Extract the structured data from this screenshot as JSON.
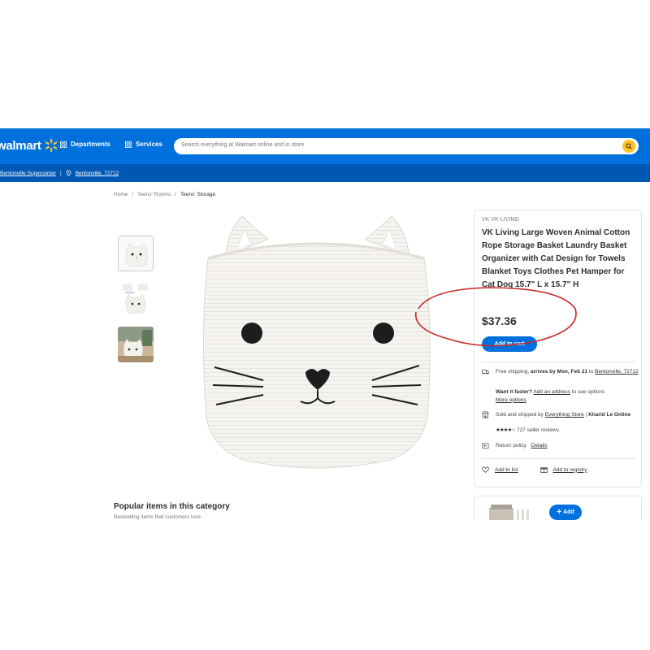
{
  "header": {
    "logo_text": "walmart",
    "departments_label": "Departments",
    "services_label": "Services",
    "search_placeholder": "Search everything at Walmart online and in store",
    "store_name": "Bentonville Supercenter",
    "location": "Bentonville, 72712",
    "colors": {
      "primary": "#0071dc",
      "secondary": "#0058b5",
      "spark": "#ffc220"
    }
  },
  "breadcrumb": [
    "Home",
    "Teens' Rooms",
    "Teens' Storage"
  ],
  "gallery": {
    "thumbnails": [
      "cat-basket-front",
      "cat-basket-variants",
      "cat-basket-lifestyle"
    ],
    "selected_index": 0
  },
  "product": {
    "brand": "VK VK-LIVING",
    "title": "VK Living Large Woven Animal Cotton Rope Storage Basket Laundry Basket Organizer with Cat Design for Towels Blanket Toys Clothes Pet Hamper for Cat Dog 15.7\" L x 15.7\" H",
    "price": "$37.36",
    "add_to_cart_label": "Add to cart"
  },
  "fulfillment": {
    "shipping_prefix": "Free shipping,",
    "shipping_bold": "arrives by Mon, Feb 21",
    "shipping_to": "to",
    "shipping_location": "Bentonville, 72712",
    "faster_label": "Want it faster?",
    "add_address_link": "Add an address",
    "see_options_text": "to see options",
    "more_options_link": "More options"
  },
  "seller": {
    "sold_by_prefix": "Sold and shipped by",
    "sold_by_link": "Everything Store",
    "separator": "|",
    "seller_name": "Kharid Le Online",
    "stars": "★★★★☆",
    "rating": 3.5,
    "reviews_text": "727 seller reviews"
  },
  "returns": {
    "label": "Return policy",
    "details_link": "Details"
  },
  "actions": {
    "add_to_list": "Add to list",
    "add_to_registry": "Add to registry"
  },
  "popular": {
    "title": "Popular items in this category",
    "subtitle": "Bestselling items that customers love"
  },
  "recommendation": {
    "add_label": "Add"
  },
  "annotation": {
    "color": "#c62828"
  }
}
